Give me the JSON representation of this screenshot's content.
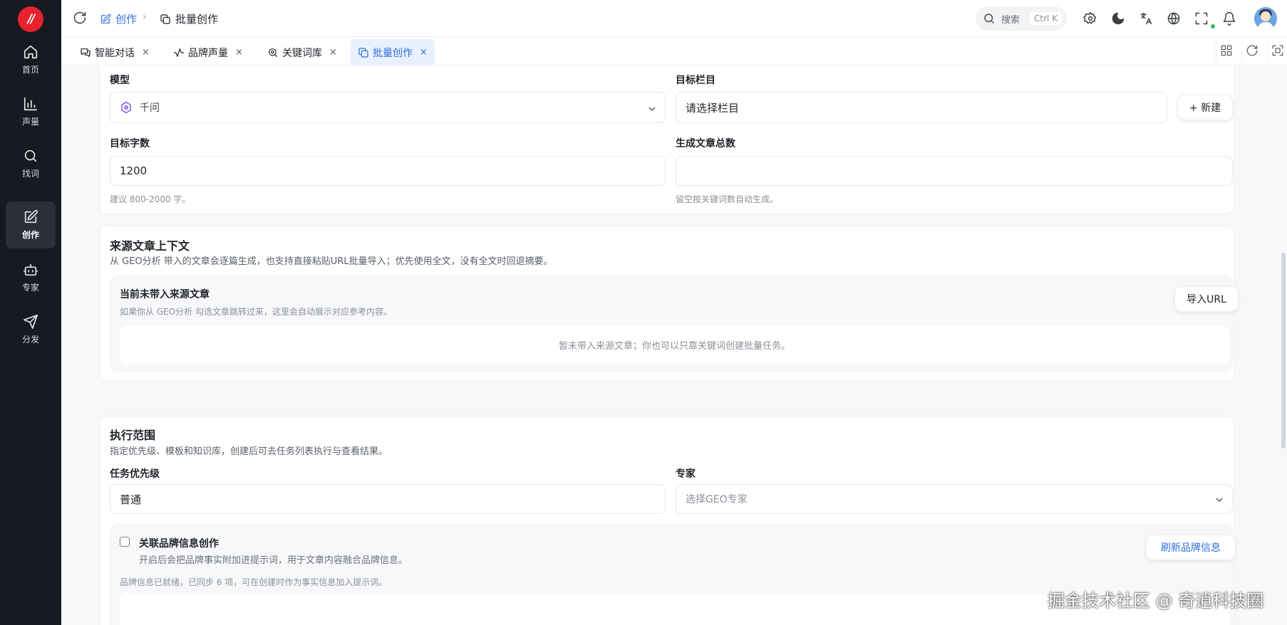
{
  "sidebar": {
    "logo_text": "//",
    "items": [
      {
        "label": "首页",
        "icon": "home-icon"
      },
      {
        "label": "声量",
        "icon": "bar-chart-icon"
      },
      {
        "label": "找词",
        "icon": "search-icon"
      },
      {
        "label": "创作",
        "icon": "edit-icon",
        "active": true
      },
      {
        "label": "专家",
        "icon": "robot-icon"
      },
      {
        "label": "分发",
        "icon": "send-icon"
      }
    ]
  },
  "header": {
    "breadcrumb": [
      "创作",
      "批量创作"
    ],
    "breadcrumb_sep": "›",
    "search_placeholder": "搜索",
    "search_shortcut": "Ctrl K"
  },
  "tabs": [
    {
      "label": "智能对话",
      "icon": "chat-icon"
    },
    {
      "label": "品牌声量",
      "icon": "activity-icon"
    },
    {
      "label": "关键词库",
      "icon": "search-zoom-icon"
    },
    {
      "label": "批量创作",
      "icon": "copy-icon",
      "active": true
    }
  ],
  "tab_close": "×",
  "form": {
    "model_label": "模型",
    "model_value": "千问",
    "target_column_label": "目标栏目",
    "target_column_placeholder": "请选择栏目",
    "new_button": "+ 新建",
    "word_count_label": "目标字数",
    "word_count_value": "1200",
    "word_count_hint": "建议 800-2000 字。",
    "total_label": "生成文章总数",
    "total_value": "",
    "total_hint": "留空按关键词数自动生成。"
  },
  "source": {
    "title": "来源文章上下文",
    "desc": "从 GEO分析 带入的文章会逐篇生成，也支持直接粘贴URL批量导入；优先使用全文，没有全文时回退摘要。",
    "inner_title": "当前未带入来源文章",
    "inner_desc": "如果你从 GEO分析 勾选文章跳转过来，这里会自动展示对应参考内容。",
    "import_button": "导入URL",
    "empty_text": "暂未带入来源文章；你也可以只靠关键词创建批量任务。"
  },
  "scope": {
    "title": "执行范围",
    "desc": "指定优先级、模板和知识库，创建后可去任务列表执行与查看结果。",
    "priority_label": "任务优先级",
    "priority_value": "普通",
    "expert_label": "专家",
    "expert_placeholder": "选择GEO专家",
    "brand_checkbox_label": "关联品牌信息创作",
    "brand_checkbox_checked": false,
    "brand_desc": "开启后会把品牌事实附加进提示词，用于文章内容融合品牌信息。",
    "refresh_button": "刷新品牌信息",
    "brand_status": "品牌信息已就绪，已同步 6 项，可在创建时作为事实信息加入提示词。"
  },
  "watermark": "掘金技术社区 @ 奇逍科技圈",
  "colors": {
    "accent": "#2f6fd8",
    "sidebar_bg": "#171a21",
    "logo_red": "#e8222c",
    "online_green": "#2fbf5b"
  }
}
